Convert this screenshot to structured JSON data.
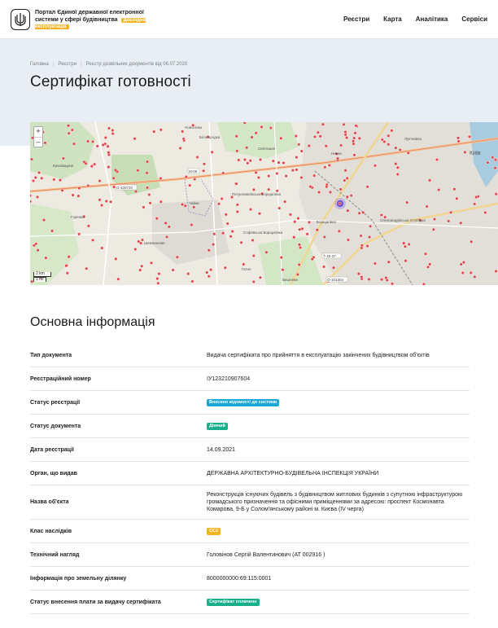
{
  "header": {
    "portal_title": "Портал Єдиної державної електронної системи у сфері будівництва",
    "test_badge": "Дослідна експлуатація",
    "nav": [
      "Реєстри",
      "Карта",
      "Аналітика",
      "Сервіси"
    ]
  },
  "breadcrumb": [
    "Головна",
    "Реєстри",
    "Реєстр дозвільних документів від 06.07.2020"
  ],
  "page_title": "Сертифікат готовності",
  "map": {
    "zoom_in": "+",
    "zoom_out": "–",
    "scale_km": "2 km",
    "scale_mi": "1 mi",
    "labels": [
      "Новосілки",
      "Білогородка",
      "Святошин",
      "Лук'янівка",
      "Вишневе",
      "Петропавлівська Борщагівка",
      "Софіївська Борщагівка",
      "Борщагівка",
      "Олександрівська Слобідка",
      "Шевченкове",
      "Горенка",
      "Гатне",
      "Нивки",
      "Київ",
      "Чайки",
      "Крюківщина"
    ],
    "road_labels": [
      "М-06",
      "Т-10-27",
      "О-101304",
      "О-100720"
    ]
  },
  "section_title": "Основна інформація",
  "info": [
    {
      "label": "Тип документа",
      "value": "Видача сертифіката про прийняття в експлуатацію закінчених будівництвом об'єктів"
    },
    {
      "label": "Реєстраційний номер",
      "value": "ІУ123210907604"
    },
    {
      "label": "Статус реєстрації",
      "status": "Внесено відомості до системи",
      "color": "#1aa7d6"
    },
    {
      "label": "Статус документа",
      "status": "Діючий",
      "color": "#1aaf8b"
    },
    {
      "label": "Дата реєстрації",
      "value": "14.09.2021"
    },
    {
      "label": "Орган, що видав",
      "value": "ДЕРЖАВНА АРХІТЕКТУРНО-БУДІВЕЛЬНА ІНСПЕКЦІЯ УКРАЇНИ"
    },
    {
      "label": "Назва об'єкта",
      "value": "Реконструкція існуючих будівель з будівництвом житлових будинків з супутною інфраструктурою громадського призначення та офісними приміщеннями за адресою: проспект Космонавта Комарова, 9-Б у Солом'янському районі м. Києва (IV черга)"
    },
    {
      "label": "Клас наслідків",
      "status": "СС2",
      "color": "#f4b21e"
    },
    {
      "label": "Технічний нагляд",
      "value": "Головінов Сергій Валентинович (АТ 002916 )"
    },
    {
      "label": "Інформація про земельну ділянку",
      "value": "8000000000:69:115:0001"
    },
    {
      "label": "Статус внесення плати за видачу сертифіката",
      "status": "Сертифікат сплачено",
      "color": "#1aaf8b"
    }
  ]
}
